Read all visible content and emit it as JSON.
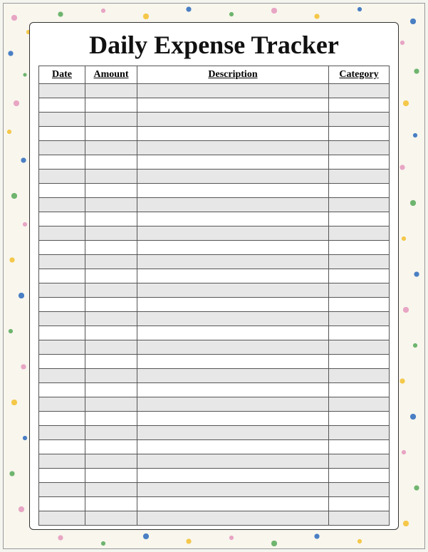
{
  "title": "Daily Expense Tracker",
  "columns": {
    "date": "Date",
    "amount": "Amount",
    "description": "Description",
    "category": "Category"
  },
  "rows": [
    {
      "date": "",
      "amount": "",
      "description": "",
      "category": ""
    },
    {
      "date": "",
      "amount": "",
      "description": "",
      "category": ""
    },
    {
      "date": "",
      "amount": "",
      "description": "",
      "category": ""
    },
    {
      "date": "",
      "amount": "",
      "description": "",
      "category": ""
    },
    {
      "date": "",
      "amount": "",
      "description": "",
      "category": ""
    },
    {
      "date": "",
      "amount": "",
      "description": "",
      "category": ""
    },
    {
      "date": "",
      "amount": "",
      "description": "",
      "category": ""
    },
    {
      "date": "",
      "amount": "",
      "description": "",
      "category": ""
    },
    {
      "date": "",
      "amount": "",
      "description": "",
      "category": ""
    },
    {
      "date": "",
      "amount": "",
      "description": "",
      "category": ""
    },
    {
      "date": "",
      "amount": "",
      "description": "",
      "category": ""
    },
    {
      "date": "",
      "amount": "",
      "description": "",
      "category": ""
    },
    {
      "date": "",
      "amount": "",
      "description": "",
      "category": ""
    },
    {
      "date": "",
      "amount": "",
      "description": "",
      "category": ""
    },
    {
      "date": "",
      "amount": "",
      "description": "",
      "category": ""
    },
    {
      "date": "",
      "amount": "",
      "description": "",
      "category": ""
    },
    {
      "date": "",
      "amount": "",
      "description": "",
      "category": ""
    },
    {
      "date": "",
      "amount": "",
      "description": "",
      "category": ""
    },
    {
      "date": "",
      "amount": "",
      "description": "",
      "category": ""
    },
    {
      "date": "",
      "amount": "",
      "description": "",
      "category": ""
    },
    {
      "date": "",
      "amount": "",
      "description": "",
      "category": ""
    },
    {
      "date": "",
      "amount": "",
      "description": "",
      "category": ""
    },
    {
      "date": "",
      "amount": "",
      "description": "",
      "category": ""
    },
    {
      "date": "",
      "amount": "",
      "description": "",
      "category": ""
    },
    {
      "date": "",
      "amount": "",
      "description": "",
      "category": ""
    },
    {
      "date": "",
      "amount": "",
      "description": "",
      "category": ""
    },
    {
      "date": "",
      "amount": "",
      "description": "",
      "category": ""
    },
    {
      "date": "",
      "amount": "",
      "description": "",
      "category": ""
    },
    {
      "date": "",
      "amount": "",
      "description": "",
      "category": ""
    },
    {
      "date": "",
      "amount": "",
      "description": "",
      "category": ""
    },
    {
      "date": "",
      "amount": "",
      "description": "",
      "category": ""
    }
  ]
}
